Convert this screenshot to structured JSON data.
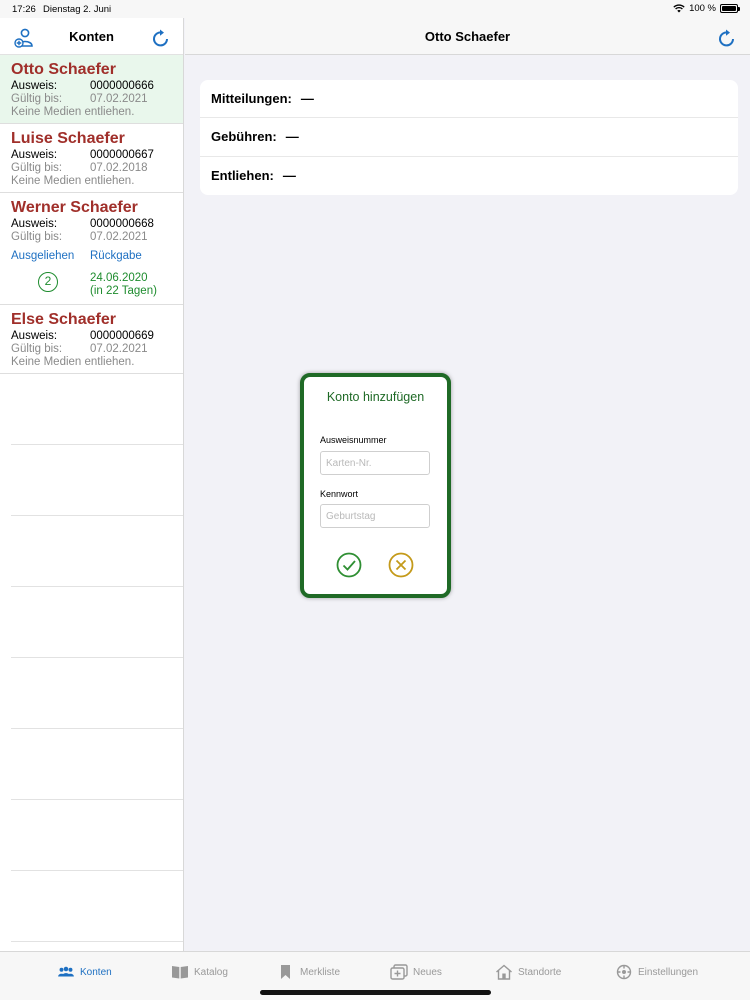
{
  "status": {
    "time": "17:26",
    "date": "Dienstag 2. Juni",
    "battery": "100 %"
  },
  "sidebar": {
    "title": "Konten",
    "accounts": [
      {
        "name": "Otto Schaefer",
        "id_label": "Ausweis:",
        "id": "0000000666",
        "valid_label": "Gültig bis:",
        "valid": "07.02.2021",
        "note": "Keine Medien entliehen."
      },
      {
        "name": "Luise Schaefer",
        "id_label": "Ausweis:",
        "id": "0000000667",
        "valid_label": "Gültig bis:",
        "valid": "07.02.2018",
        "note": "Keine Medien entliehen."
      },
      {
        "name": "Werner Schaefer",
        "id_label": "Ausweis:",
        "id": "0000000668",
        "valid_label": "Gültig bis:",
        "valid": "07.02.2021",
        "link_borrowed": "Ausgeliehen",
        "link_return": "Rückgabe",
        "loan_count": "2",
        "due_date": "24.06.2020",
        "due_days": "(in 22 Tagen)"
      },
      {
        "name": "Else Schaefer",
        "id_label": "Ausweis:",
        "id": "0000000669",
        "valid_label": "Gültig bis:",
        "valid": "07.02.2021",
        "note": "Keine Medien entliehen."
      }
    ]
  },
  "main": {
    "title": "Otto Schaefer",
    "items": [
      {
        "label": "Mitteilungen:",
        "value": "—"
      },
      {
        "label": "Gebühren:",
        "value": "—"
      },
      {
        "label": "Entliehen:",
        "value": "—"
      }
    ]
  },
  "dialog": {
    "title": "Konto hinzufügen",
    "card_label": "Ausweisnummer",
    "card_placeholder": "Karten-Nr.",
    "password_label": "Kennwort",
    "password_placeholder": "Geburtstag"
  },
  "tabs": [
    {
      "label": "Konten",
      "icon": "people-icon",
      "active": true
    },
    {
      "label": "Katalog",
      "icon": "book-icon",
      "active": false
    },
    {
      "label": "Merkliste",
      "icon": "bookmark-icon",
      "active": false
    },
    {
      "label": "Neues",
      "icon": "new-items-icon",
      "active": false
    },
    {
      "label": "Standorte",
      "icon": "house-icon",
      "active": false
    },
    {
      "label": "Einstellungen",
      "icon": "gear-icon",
      "active": false
    }
  ],
  "colors": {
    "accent": "#1e70c2",
    "name": "#a02f2a",
    "green": "#1f6a26",
    "selected_bg": "#e9f7ec",
    "cancel": "#c49a1a"
  }
}
